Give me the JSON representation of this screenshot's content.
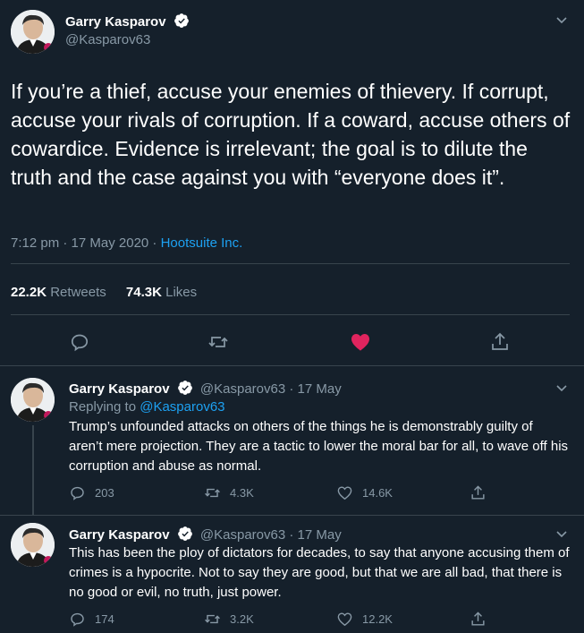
{
  "main_tweet": {
    "author": "Garry Kasparov",
    "handle": "@Kasparov63",
    "text": "If you’re a thief, accuse your enemies of thievery. If corrupt, accuse your rivals of corruption. If a coward, accuse others of cowardice. Evidence is irrelevant; the goal is to dilute the truth and the case against you with “everyone does it”.",
    "time": "7:12 pm · 17 May 2020 · ",
    "source": "Hootsuite Inc.",
    "retweets_count": "22.2K",
    "retweets_label": "Retweets",
    "likes_count": "74.3K",
    "likes_label": "Likes",
    "liked": true
  },
  "replies": [
    {
      "author": "Garry Kasparov",
      "handle_date": "@Kasparov63 · 17 May",
      "replying_prefix": "Replying to ",
      "replying_to": "@Kasparov63",
      "text": "Trump’s unfounded attacks on others of the things he is demonstrably guilty of aren’t mere projection. They are a tactic to lower the moral bar for all, to wave off his corruption and abuse as normal.",
      "reply_count": "203",
      "retweet_count": "4.3K",
      "like_count": "14.6K"
    },
    {
      "author": "Garry Kasparov",
      "handle_date": "@Kasparov63 · 17 May",
      "text": "This has been the ploy of dictators for decades, to say that anyone accusing them of crimes is a hypocrite. Not to say they are good, but that we are all bad, that there is no good or evil, no truth, just power.",
      "reply_count": "174",
      "retweet_count": "3.2K",
      "like_count": "12.2K"
    }
  ],
  "colors": {
    "background": "#15202b",
    "accent": "#1da1f2",
    "muted": "#8899a6",
    "like": "#e0245e",
    "divider": "#38444d"
  }
}
